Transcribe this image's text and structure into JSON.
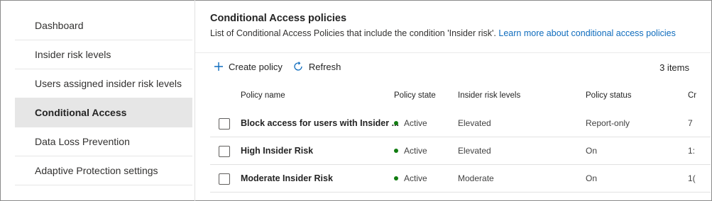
{
  "sidebar": {
    "items": [
      {
        "label": "Dashboard"
      },
      {
        "label": "Insider risk levels"
      },
      {
        "label": "Users assigned insider risk levels"
      },
      {
        "label": "Conditional Access"
      },
      {
        "label": "Data Loss Prevention"
      },
      {
        "label": "Adaptive Protection settings"
      }
    ],
    "active_index": 3
  },
  "main": {
    "title": "Conditional Access policies",
    "subtitle": "List of Conditional Access Policies that include the condition 'Insider risk'.",
    "learn_more_link": "Learn more about conditional access policies",
    "toolbar": {
      "create_label": "Create policy",
      "refresh_label": "Refresh",
      "create_icon": "add-icon",
      "refresh_icon": "refresh-icon"
    },
    "item_count": "3 items",
    "table": {
      "columns": [
        "Policy name",
        "Policy state",
        "Insider risk levels",
        "Policy status",
        "Cr"
      ],
      "rows": [
        {
          "name": "Block access for users with Insider ...",
          "state": "Active",
          "risk_level": "Elevated",
          "status": "Report-only",
          "extra": "7"
        },
        {
          "name": "High Insider Risk",
          "state": "Active",
          "risk_level": "Elevated",
          "status": "On",
          "extra": "1:"
        },
        {
          "name": "Moderate Insider Risk",
          "state": "Active",
          "risk_level": "Moderate",
          "status": "On",
          "extra": "1("
        }
      ]
    }
  },
  "colors": {
    "active_nav_bg": "#e6e6e6",
    "link": "#0f6cbd",
    "status_active": "#107c10",
    "accent_icon": "#0f6cbd"
  }
}
